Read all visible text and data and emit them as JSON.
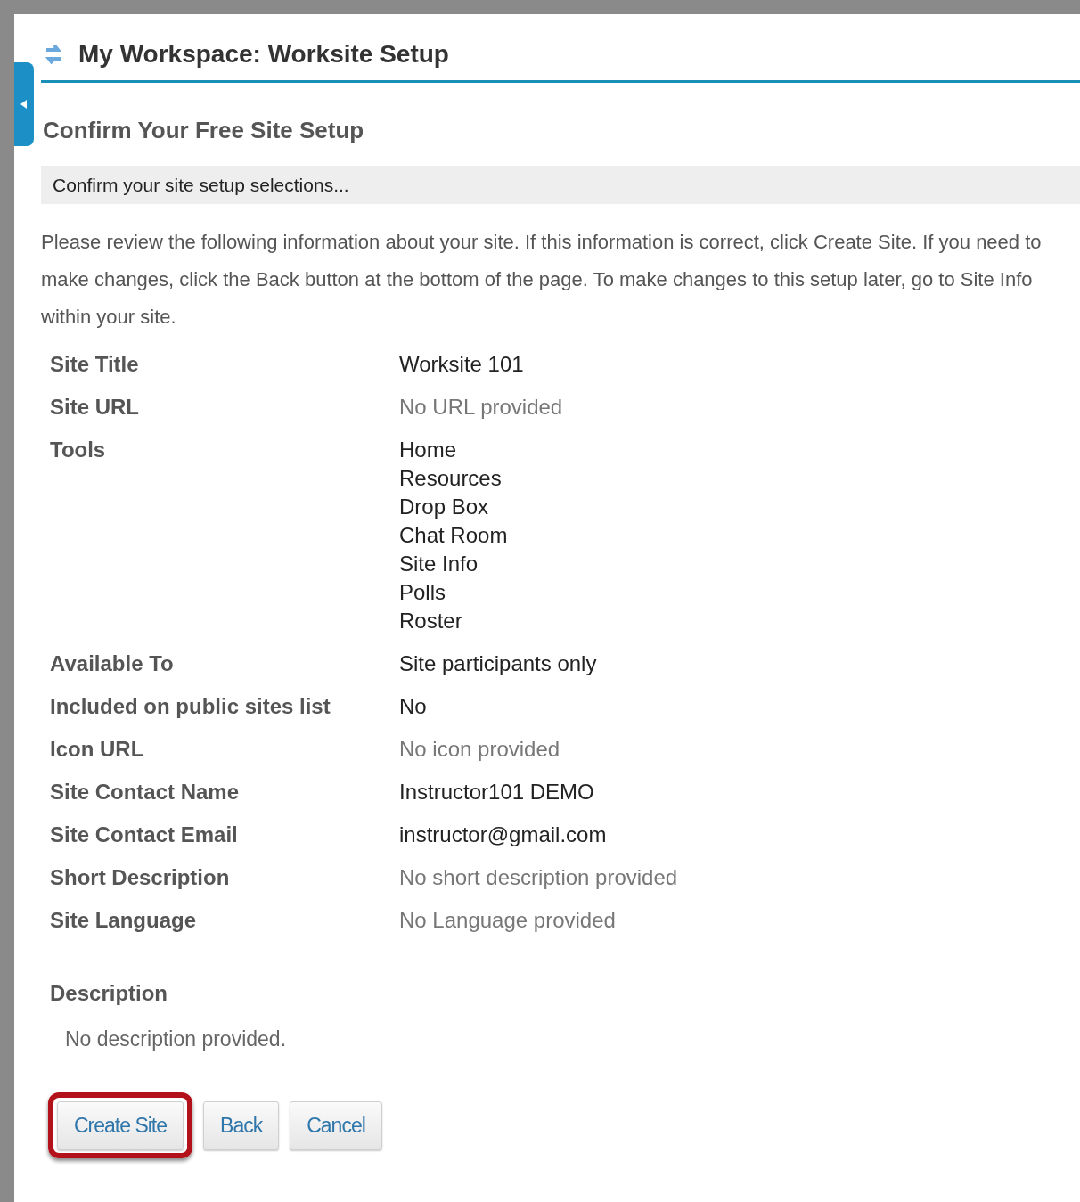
{
  "header": {
    "title": "My Workspace: Worksite Setup"
  },
  "sidebar_toggle": {
    "expanded": false
  },
  "section_title": "Confirm Your Free Site Setup",
  "instruction_bar": "Confirm your site setup selections...",
  "intro": "Please review the following information about your site. If this information is correct, click Create Site. If you need to make changes, click the Back button at the bottom of the page. To make changes to this setup later, go to Site Info within your site.",
  "fields": [
    {
      "label": "Site Title",
      "values": [
        "Worksite 101"
      ],
      "muted": false
    },
    {
      "label": "Site URL",
      "values": [
        "No URL provided"
      ],
      "muted": true
    },
    {
      "label": "Tools",
      "values": [
        "Home",
        "Resources",
        "Drop Box",
        "Chat Room",
        "Site Info",
        "Polls",
        "Roster"
      ],
      "muted": false
    },
    {
      "label": "Available To",
      "values": [
        "Site participants only"
      ],
      "muted": false
    },
    {
      "label": "Included on public sites list",
      "values": [
        "No"
      ],
      "muted": false
    },
    {
      "label": "Icon URL",
      "values": [
        "No icon provided"
      ],
      "muted": true
    },
    {
      "label": "Site Contact Name",
      "values": [
        "Instructor101 DEMO"
      ],
      "muted": false
    },
    {
      "label": "Site Contact Email",
      "values": [
        "instructor@gmail.com"
      ],
      "muted": false
    },
    {
      "label": "Short Description",
      "values": [
        "No short description provided"
      ],
      "muted": true
    },
    {
      "label": "Site Language",
      "values": [
        "No Language provided"
      ],
      "muted": true
    }
  ],
  "description": {
    "label": "Description",
    "text": "No description provided."
  },
  "buttons": [
    {
      "label": "Create Site",
      "highlighted": true
    },
    {
      "label": "Back",
      "highlighted": false
    },
    {
      "label": "Cancel",
      "highlighted": false
    }
  ]
}
